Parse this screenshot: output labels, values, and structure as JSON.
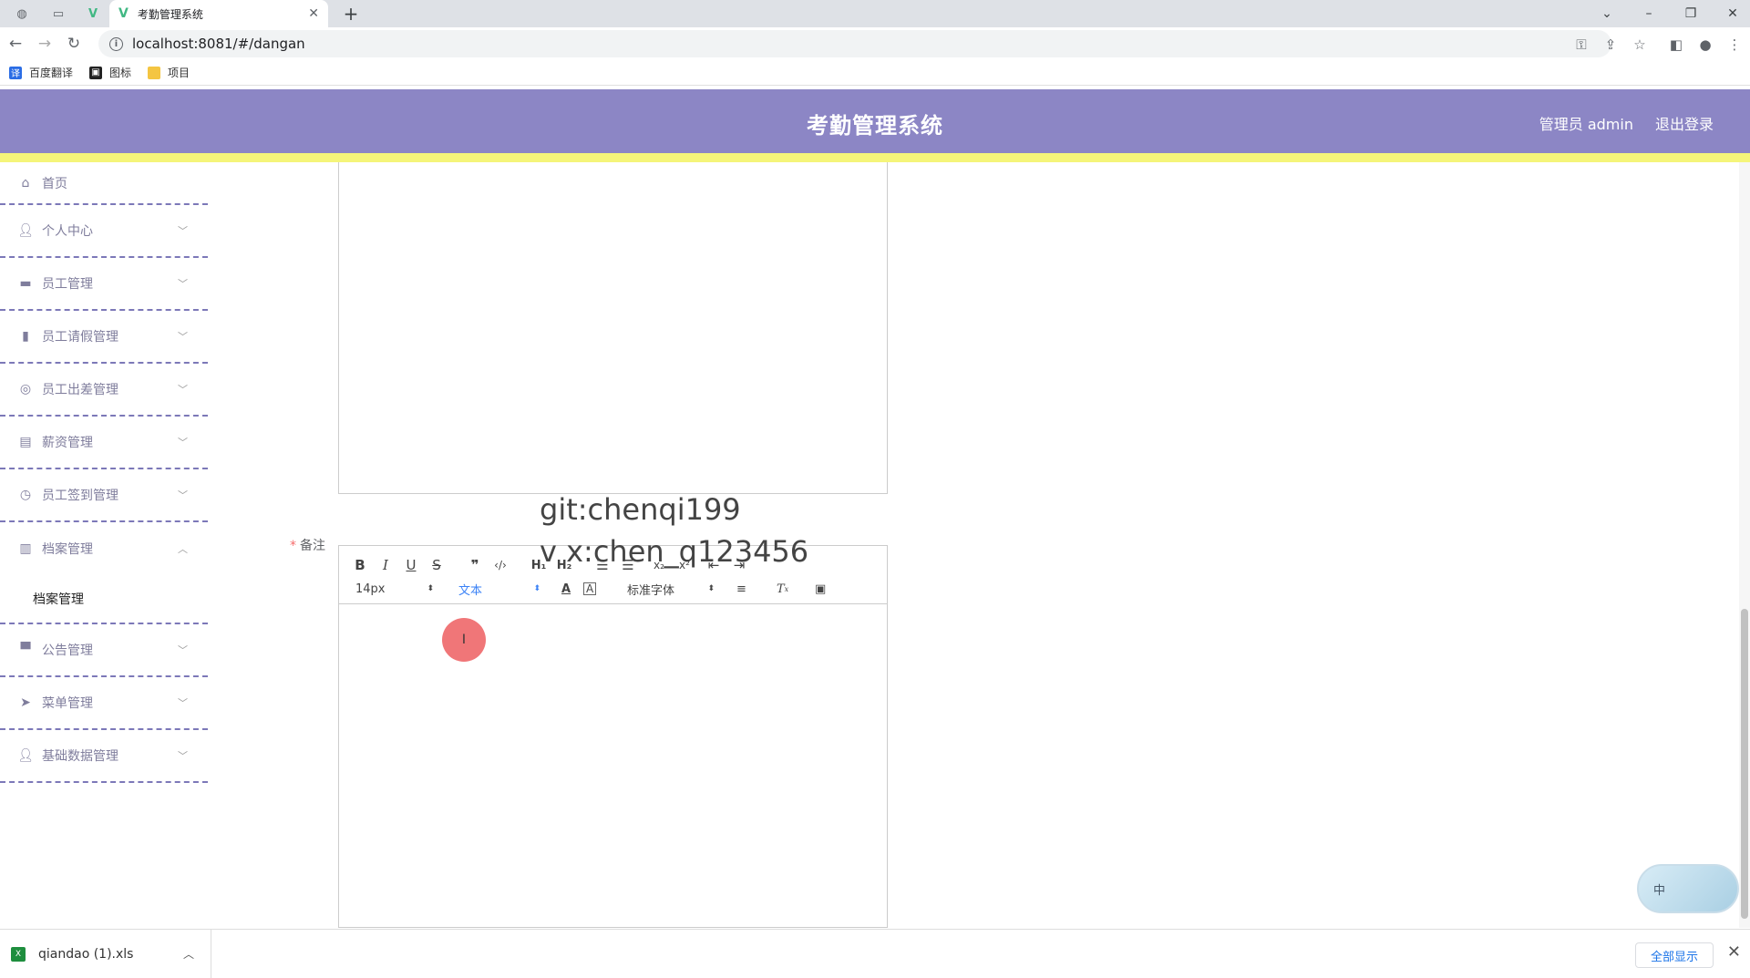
{
  "browser": {
    "tab_title": "考勤管理系统",
    "url": "localhost:8081/#/dangan",
    "bookmarks": [
      {
        "label": "百度翻译",
        "color": "#2b6de5"
      },
      {
        "label": "图标",
        "color": "#222222"
      },
      {
        "label": "项目",
        "color": "#f4c542"
      }
    ]
  },
  "header": {
    "title": "考勤管理系统",
    "user_label": "管理员 admin",
    "logout_label": "退出登录",
    "bg_color": "#8c86c5",
    "strip_color": "#f5f57a"
  },
  "sidebar": {
    "items": [
      {
        "label": "首页",
        "icon": "home-icon"
      },
      {
        "label": "个人中心",
        "icon": "user-icon"
      },
      {
        "label": "员工管理",
        "icon": "briefcase-icon"
      },
      {
        "label": "员工请假管理",
        "icon": "bar-chart-icon"
      },
      {
        "label": "员工出差管理",
        "icon": "aperture-icon"
      },
      {
        "label": "薪资管理",
        "icon": "suitcase-icon"
      },
      {
        "label": "员工签到管理",
        "icon": "clock-icon"
      },
      {
        "label": "档案管理",
        "icon": "document-icon"
      },
      {
        "label": "公告管理",
        "icon": "monitor-icon"
      },
      {
        "label": "菜单管理",
        "icon": "send-icon"
      },
      {
        "label": "基础数据管理",
        "icon": "user-icon"
      }
    ],
    "active_sub_item": "档案管理"
  },
  "form": {
    "remark_label": "备注",
    "toolbar": {
      "font_size": "14px",
      "header_select": "文本",
      "font_family": "标准字体"
    }
  },
  "watermark": {
    "line1": "git:chenqi199",
    "line2": "v x:chen_q123456"
  },
  "float_widget": {
    "label": "中"
  },
  "download": {
    "file_name": "qiandao (1).xls",
    "show_all_label": "全部显示"
  }
}
